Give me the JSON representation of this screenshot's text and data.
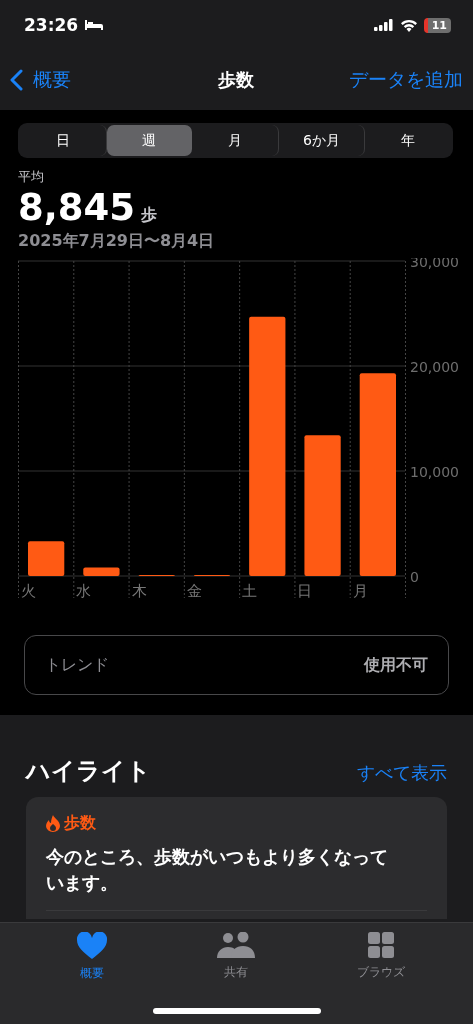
{
  "status_bar": {
    "time": "23:26",
    "battery": "11"
  },
  "nav": {
    "back": "概要",
    "title": "歩数",
    "action": "データを追加"
  },
  "segments": [
    {
      "label": "日",
      "selected": false
    },
    {
      "label": "週",
      "selected": true
    },
    {
      "label": "月",
      "selected": false
    },
    {
      "label": "6か月",
      "selected": false
    },
    {
      "label": "年",
      "selected": false
    }
  ],
  "summary": {
    "label": "平均",
    "value": "8,845",
    "unit": "歩",
    "range": "2025年7月29日〜8月4日"
  },
  "chart_data": {
    "type": "bar",
    "categories": [
      "火",
      "水",
      "木",
      "金",
      "土",
      "日",
      "月"
    ],
    "series": [
      {
        "color": "#ff5a14",
        "values": [
          3300,
          800,
          100,
          100,
          24700,
          13400,
          19300
        ]
      }
    ],
    "ylim": [
      0,
      30000
    ],
    "yticks": [
      {
        "value": 0,
        "label": "0"
      },
      {
        "value": 10000,
        "label": "10,000"
      },
      {
        "value": 20000,
        "label": "20,000"
      },
      {
        "value": 30000,
        "label": "30,000"
      }
    ]
  },
  "trend": {
    "label": "トレンド",
    "value": "使用不可"
  },
  "highlights": {
    "title": "ハイライト",
    "link": "すべて表示",
    "card": {
      "category": "歩数",
      "text": "今のところ、歩数がいつもより多くなっています。"
    }
  },
  "tab_bar": [
    {
      "label": "概要",
      "kind": "heart",
      "selected": true
    },
    {
      "label": "共有",
      "kind": "people",
      "selected": false
    },
    {
      "label": "ブラウズ",
      "kind": "grid",
      "selected": false
    }
  ]
}
